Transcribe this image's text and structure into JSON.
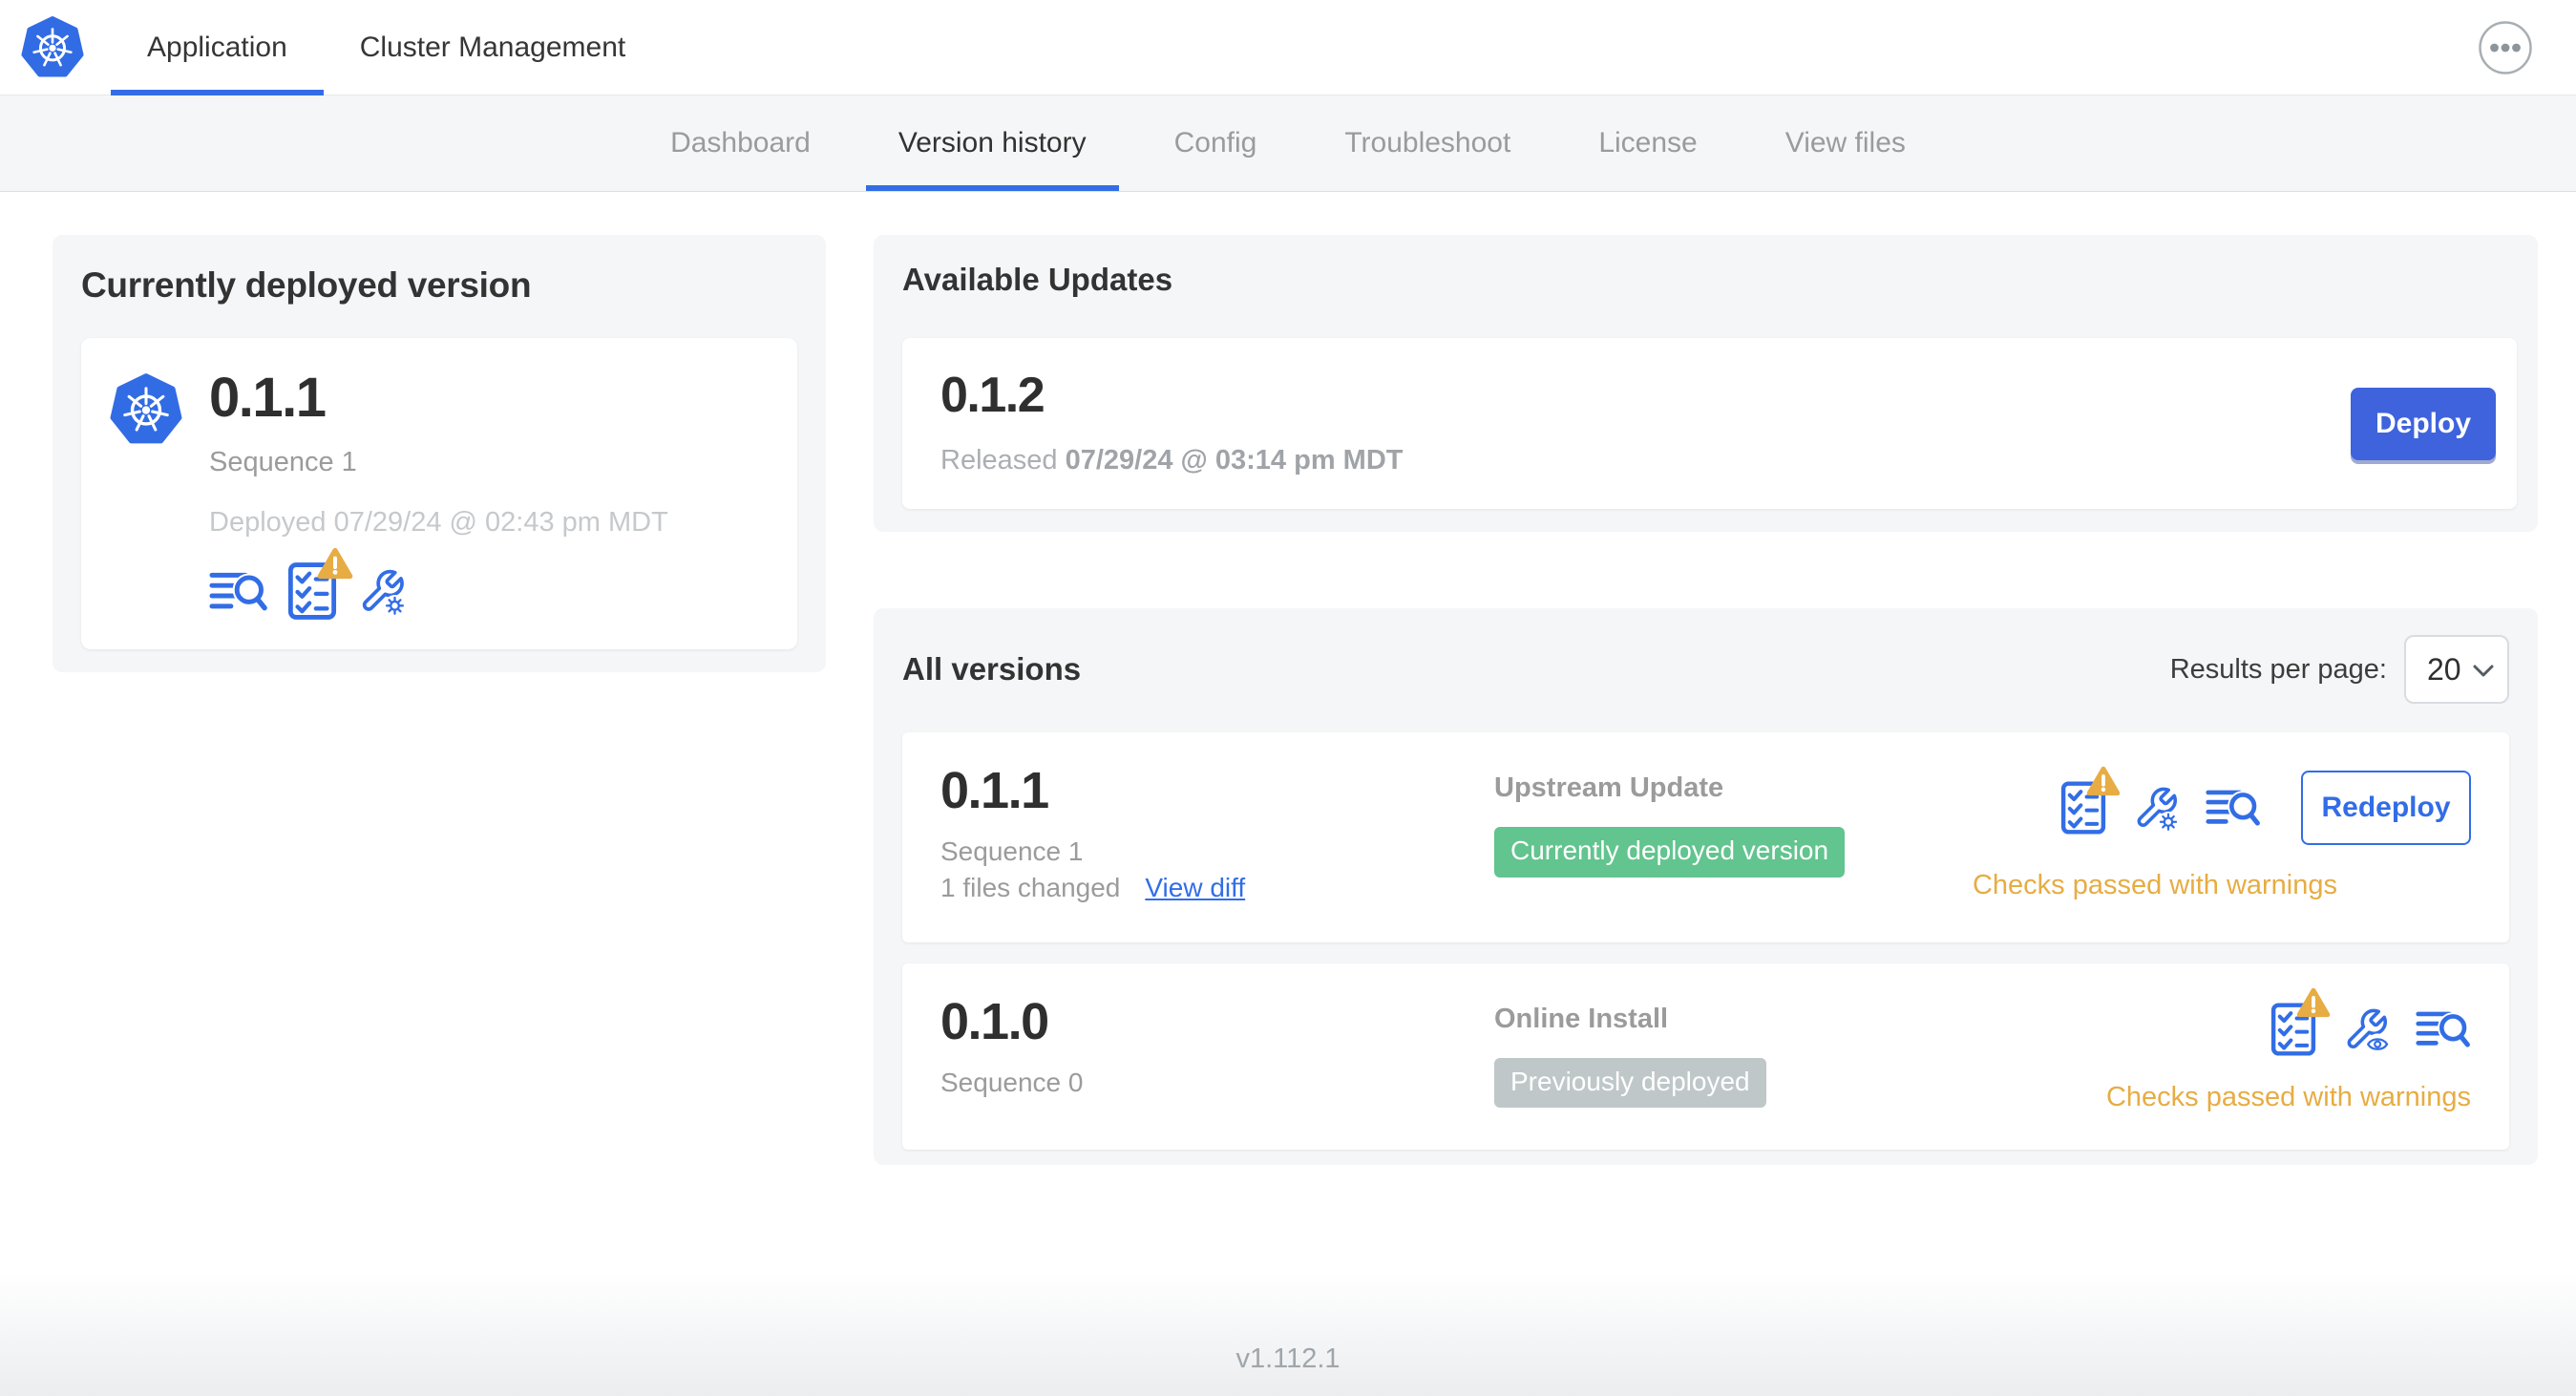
{
  "colors": {
    "accent_blue": "#326DE6",
    "deploy_button_blue": "#3E63DC",
    "success_green": "#62C48E",
    "muted_badge_gray": "#BFC7C9",
    "warning_amber": "#E7AC43",
    "k8s_logo_blue": "#326CE5"
  },
  "topnav": {
    "tabs": [
      {
        "label": "Application",
        "active": true
      },
      {
        "label": "Cluster Management",
        "active": false
      }
    ],
    "icons": [
      "kubernetes-logo",
      "ellipsis-menu-icon"
    ]
  },
  "subnav": {
    "items": [
      {
        "label": "Dashboard",
        "active": false
      },
      {
        "label": "Version history",
        "active": true
      },
      {
        "label": "Config",
        "active": false
      },
      {
        "label": "Troubleshoot",
        "active": false
      },
      {
        "label": "License",
        "active": false
      },
      {
        "label": "View files",
        "active": false
      }
    ]
  },
  "deployed_card": {
    "title": "Currently deployed version",
    "version": "0.1.1",
    "sequence": "Sequence 1",
    "deployed_text": "Deployed 07/29/24 @ 02:43 pm MDT",
    "icons": [
      "logs-icon",
      "preflight-checks-warning-icon",
      "edit-config-icon"
    ]
  },
  "available_updates": {
    "title": "Available Updates",
    "update": {
      "version": "0.1.2",
      "released_prefix": "Released",
      "released_date": "07/29/24 @ 03:14 pm MDT",
      "deploy_label": "Deploy"
    }
  },
  "all_versions": {
    "title": "All versions",
    "results_per_page_label": "Results per page:",
    "results_per_page_value": "20",
    "rows": [
      {
        "version": "0.1.1",
        "sequence": "Sequence 1",
        "files_changed": "1 files changed",
        "view_diff_label": "View diff",
        "source": "Upstream Update",
        "badge_label": "Currently deployed version",
        "badge_style": "green",
        "status_text": "Checks passed with warnings",
        "action_label": "Redeploy",
        "icons": [
          "preflight-checks-warning-icon",
          "edit-config-icon",
          "logs-icon"
        ]
      },
      {
        "version": "0.1.0",
        "sequence": "Sequence 0",
        "source": "Online Install",
        "badge_label": "Previously deployed",
        "badge_style": "gray",
        "status_text": "Checks passed with warnings",
        "icons": [
          "preflight-checks-warning-icon",
          "view-config-icon",
          "logs-icon"
        ]
      }
    ]
  },
  "footer": {
    "version_label": "v1.112.1"
  }
}
